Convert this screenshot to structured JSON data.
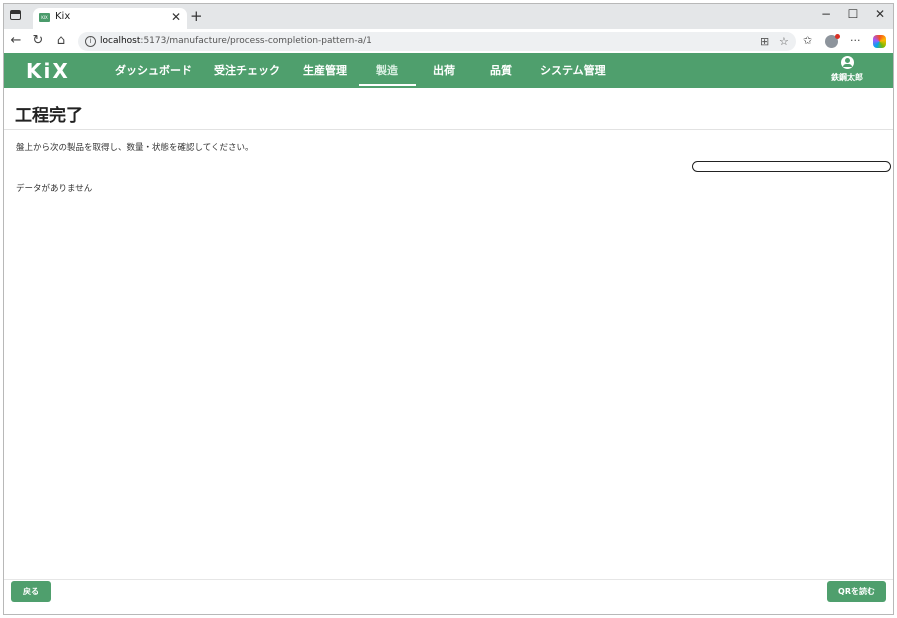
{
  "browser": {
    "tab_title": "Kix",
    "tab_favicon_text": "KIX",
    "url_host": "localhost",
    "url_path": ":5173/manufacture/process-completion-pattern-a/1"
  },
  "app": {
    "logo": "KiX",
    "nav": [
      "ダッシュボード",
      "受注チェック",
      "生産管理",
      "製造",
      "出荷",
      "品質",
      "システム管理"
    ],
    "active_nav": "製造",
    "user_name": "鉄鋼太郎",
    "brand_color": "#4f9f6d"
  },
  "page": {
    "title": "工程完了",
    "instruction": "盤上から次の製品を取得し、数量・状態を確認してください。",
    "scan_input_value": "",
    "empty_message": "データがありません"
  },
  "footer": {
    "back_label": "戻る",
    "qr_label": "QRを読む"
  }
}
